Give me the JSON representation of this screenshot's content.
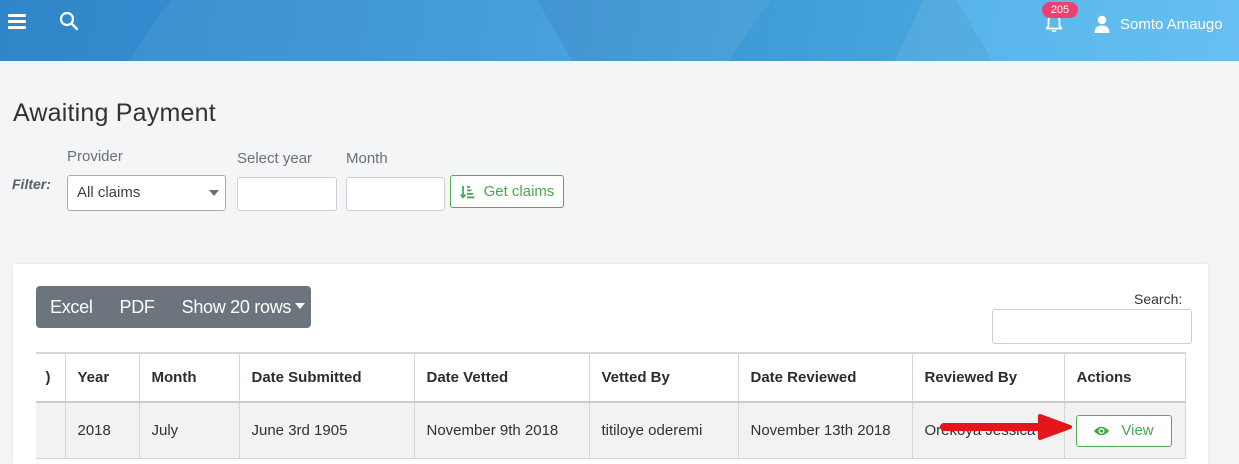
{
  "header": {
    "notification_count": "205",
    "user_name": "Somto Amaugo"
  },
  "page": {
    "title": "Awaiting Payment"
  },
  "filter": {
    "label": "Filter:",
    "provider_label": "Provider",
    "provider_value": "All claims",
    "year_label": "Select year",
    "year_value": "",
    "month_label": "Month",
    "month_value": "",
    "submit_label": "Get claims"
  },
  "toolbar": {
    "excel_label": "Excel",
    "pdf_label": "PDF",
    "rows_label": "Show 20 rows",
    "search_label": "Search:",
    "search_value": ""
  },
  "table": {
    "columns": [
      ")",
      "Year",
      "Month",
      "Date Submitted",
      "Date Vetted",
      "Vetted By",
      "Date Reviewed",
      "Reviewed By",
      "Actions"
    ],
    "rows": [
      {
        "first": "",
        "year": "2018",
        "month": "July",
        "date_submitted": "June 3rd 1905",
        "date_vetted": "November 9th 2018",
        "vetted_by": "titiloye oderemi",
        "date_reviewed": "November 13th 2018",
        "reviewed_by": "Orekoya Jessica O",
        "action_label": "View"
      }
    ]
  },
  "colors": {
    "header_gradient_start": "#2f86c9",
    "header_gradient_end": "#5cbcf0",
    "badge": "#ef3f6e",
    "success": "#47a84e",
    "button_group": "#6c757d",
    "annotation_arrow": "#e3161c"
  },
  "icons": {
    "menu": "hamburger-icon",
    "search": "search-icon",
    "notifications": "bell-icon",
    "user": "user-icon",
    "get_claims": "sort-amount-icon",
    "view": "eye-icon"
  }
}
